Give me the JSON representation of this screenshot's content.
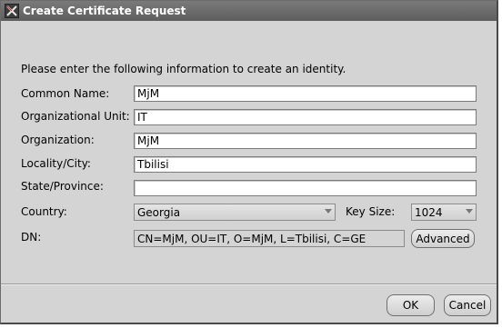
{
  "window": {
    "title": "Create Certificate Request"
  },
  "intro": "Please enter the following information to create an identity.",
  "form": {
    "common_name": {
      "label": "Common Name:",
      "value": "MjM"
    },
    "organizational_unit": {
      "label": "Organizational Unit:",
      "value": "IT"
    },
    "organization": {
      "label": "Organization:",
      "value": "MjM"
    },
    "locality": {
      "label": "Locality/City:",
      "value": "Tbilisi"
    },
    "state": {
      "label": "State/Province:",
      "value": ""
    },
    "country": {
      "label": "Country:",
      "value": "Georgia"
    },
    "key_size": {
      "label": "Key Size:",
      "value": "1024"
    },
    "dn": {
      "label": "DN:",
      "value": "CN=MjM, OU=IT, O=MjM, L=Tbilisi, C=GE"
    }
  },
  "buttons": {
    "advanced": "Advanced",
    "ok": "OK",
    "cancel": "Cancel"
  },
  "icons": {
    "app": "app-x-icon",
    "dropdown": "chevron-down-icon"
  },
  "colors": {
    "titlebar": "#6a6a6a",
    "dialog_bg": "#d4d4d4"
  }
}
